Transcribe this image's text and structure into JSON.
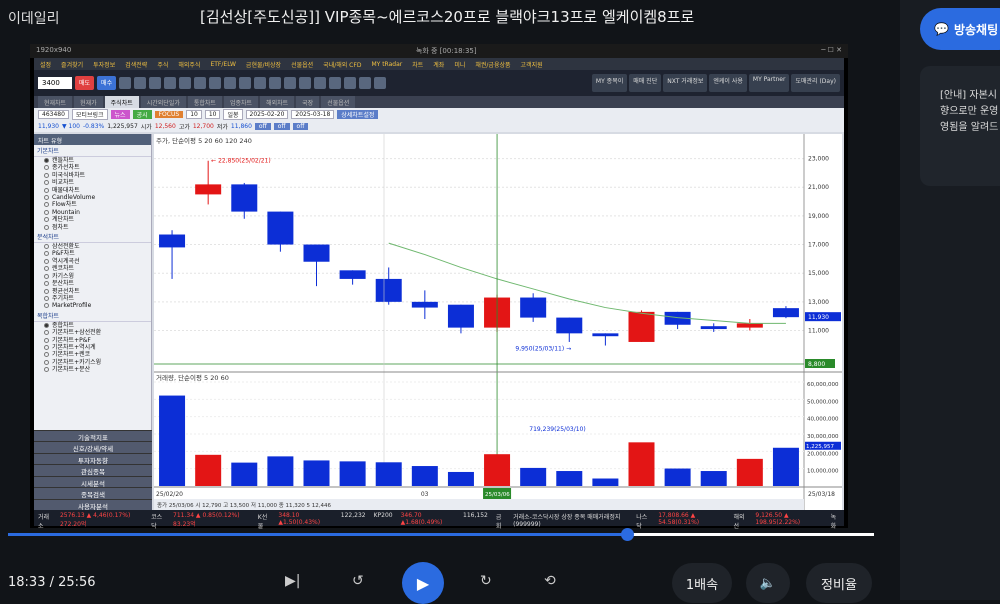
{
  "page": {
    "brand": "이데일리",
    "title": "[김선상[주도신공]] VIP종목~에르코스20프로 블랙야크13프로 엘케이켐8프로"
  },
  "video": {
    "header_left": "1920x940",
    "header_center": "녹화 중 [00:18:35]",
    "menu": [
      "설정",
      "즐겨찾기",
      "투자정보",
      "검색전략",
      "주식",
      "해외주식",
      "ETF/ELW",
      "금현물/비상장",
      "선물옵션",
      "국내/해외 CFD",
      "MY tRadar",
      "차트",
      "계좌",
      "미니",
      "채권/금융상품",
      "고객지원"
    ],
    "toolbar": {
      "code": "3400",
      "sell": "매도",
      "buy": "매수",
      "right_btns": [
        "MY 종목이",
        "매매 진단",
        "NXT 거래정보",
        "엔케이 사용",
        "MY Partner",
        "도매관리 (Day)"
      ]
    },
    "tabs": [
      "현재차트",
      "현재가",
      "주식차트",
      "시간외단일가",
      "통합차트",
      "업종차트",
      "해외차트",
      "국장",
      "선물옵션"
    ],
    "row1": {
      "stock_code": "463480",
      "stock_name": "모티브링크",
      "btn1": "뉴스",
      "btn2": "공시",
      "btn3": "FOCUS",
      "period1": "10",
      "period2": "10",
      "freq": "일봉",
      "date_from": "2025-02-20",
      "date_to": "2025-03-18",
      "btn_detail": "상세차트설정"
    },
    "row2": {
      "price": "11,930",
      "chg": "▼ 100",
      "pct": "-0.83%",
      "vol": "1,225,957",
      "open_label": "시가",
      "open": "12,560",
      "high_label": "고가",
      "high": "12,700",
      "low_label": "저가",
      "low": "11,860",
      "off1": "off",
      "off2": "off",
      "off3": "off"
    },
    "sub_tab": "모티브링크 (코스닥)",
    "left_title": "차트 유형",
    "left_groups": [
      {
        "name": "기본차트",
        "items": [
          "캔들차트",
          "종가선차트",
          "미국식바차트",
          "비교차트",
          "매물대차트",
          "CandleVolume",
          "Flow차트",
          "Mountain",
          "계단차트",
          "점차트"
        ]
      },
      {
        "name": "분석차트",
        "items": [
          "삼선전환도",
          "P&F차트",
          "역시계곡선",
          "렌코차트",
          "카기스윙",
          "분산차트",
          "평균선차트",
          "주기차트",
          "MarketProfile"
        ]
      },
      {
        "name": "복합차트",
        "items": [
          "종합차트",
          "기본차트+삼선전환",
          "기본차트+P&F",
          "기본차트+역시계",
          "기본차트+렌코",
          "기본차트+카기스윙",
          "기본차트+분산"
        ]
      }
    ],
    "left_bottom": [
      "기술적지표",
      "신호/강세/약세",
      "투자자동향",
      "관심종목",
      "시세분석",
      "종목검색",
      "사용자분석"
    ],
    "status": {
      "kospi_label": "거래소",
      "kospi": "2576.13 ▲ 4,46(0.17%) 272.20억",
      "kosdaq_label": "코스닥",
      "kosdaq": "711.34 ▲ 0.85(0.12%) 83.23억",
      "k200_label": "K선물",
      "k200": "348.10 ▲1.50(0.43%)",
      "k200v": "122,232",
      "kpi": "KP200",
      "kpi_v": "346.70 ▲1.68(0.49%)",
      "kpi2": "116,152",
      "news": "금회",
      "news_text": "거래소-코스닥시장 상장 종목 매매거래정지 (999999)",
      "nasdaq_label": "나스닥",
      "nasdaq": "17,808.66 ▲ 54.58(0.31%)",
      "fut_label": "해외선",
      "fut": "9,126.50 ▲ 198.95(2.22%)",
      "logo_time": "녹화"
    }
  },
  "chart_data": {
    "type": "candlestick",
    "title": "주가, 단순이평 5 20 60 120 240",
    "volume_title": "거래량, 단순이평 5 20 60",
    "dates": [
      "25/02/20",
      "25/02/21",
      "25/02/24",
      "25/02/25",
      "25/02/26",
      "25/02/27",
      "25/02/28",
      "25/03/04",
      "25/03/05",
      "25/03/06",
      "25/03/07",
      "25/03/10",
      "25/03/11",
      "25/03/12",
      "25/03/13",
      "25/03/14",
      "25/03/17",
      "25/03/18"
    ],
    "ohlc": [
      [
        17700,
        18000,
        14600,
        16800
      ],
      [
        20500,
        22850,
        19800,
        21200
      ],
      [
        21200,
        21300,
        18800,
        19300
      ],
      [
        19300,
        19300,
        16500,
        17000
      ],
      [
        17000,
        17000,
        14100,
        15800
      ],
      [
        15200,
        15200,
        14200,
        14600
      ],
      [
        14600,
        15400,
        12800,
        13000
      ],
      [
        13000,
        13800,
        11800,
        12600
      ],
      [
        12800,
        12800,
        10800,
        11200
      ],
      [
        11200,
        13500,
        10900,
        13300
      ],
      [
        13300,
        13600,
        11600,
        11900
      ],
      [
        11900,
        11900,
        10200,
        10800
      ],
      [
        10800,
        10800,
        9950,
        10600
      ],
      [
        10200,
        12400,
        10200,
        12300
      ],
      [
        12300,
        12300,
        11100,
        11400
      ],
      [
        11300,
        11500,
        10900,
        11100
      ],
      [
        11200,
        11800,
        11000,
        11500
      ],
      [
        12560,
        12700,
        11860,
        11930
      ]
    ],
    "ma20": [
      null,
      null,
      null,
      null,
      null,
      null,
      17100,
      16300,
      15400,
      14600,
      13900,
      13200,
      12600,
      12200,
      11900,
      11700,
      11500,
      11500
    ],
    "volumes": [
      2900000,
      1000000,
      750000,
      950000,
      820000,
      790000,
      760000,
      640000,
      450000,
      1020000,
      580000,
      480000,
      240000,
      1400000,
      560000,
      480000,
      870000,
      1225957
    ],
    "ylim": [
      8800,
      23600
    ],
    "y_ticks": [
      "23,000",
      "21,000",
      "19,000",
      "17,000",
      "15,000",
      "13,000",
      "11,000"
    ],
    "vol_ticks": [
      "60,000,000",
      "50,000,000",
      "40,000,000",
      "30,000,000",
      "20,000,000",
      "10,000,000"
    ],
    "annotations": {
      "high": "22,850(25/02/21)",
      "low": "9,950(25/03/11)",
      "vol_mark": "719,239(25/03/10)",
      "price_tag": "11,930",
      "cross_price": "8,800",
      "vol_tag": "1,225,957"
    },
    "x_labels": [
      "25/02/20",
      "03",
      "25/03/06",
      "25/03/18"
    ],
    "footer": "종가 25/03/06 시 12,790 고 13,500 저 11,000 종 11,320 5 12,446"
  },
  "player": {
    "time": "18:33 / 25:56",
    "progress": 0.715,
    "speed": "1배속",
    "ratio": "정비율"
  },
  "side": {
    "broadcast_btn": "방송채팅",
    "notice": [
      "[안내] 자본시",
      "향으로만 운영",
      "영됨을 알려드"
    ]
  }
}
